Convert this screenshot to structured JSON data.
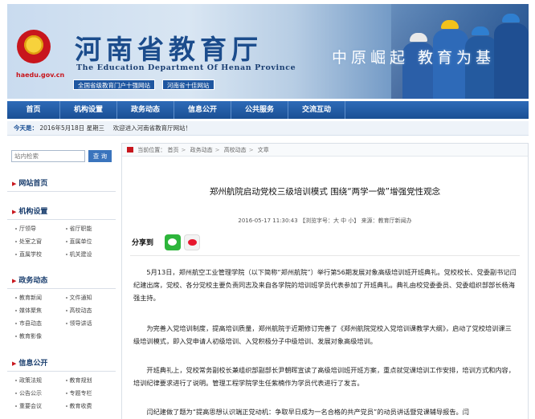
{
  "header": {
    "site_url": "haedu.gov.cn",
    "title_cn": "河南省教育厅",
    "title_en": "The Education Department Of Henan Province",
    "badge_1": "全国省级教育门户十强网站",
    "badge_2": "河南省十佳网站",
    "slogan": "中原崛起 教育为基"
  },
  "nav": {
    "items": [
      "首页",
      "机构设置",
      "政务动态",
      "信息公开",
      "公共服务",
      "交流互动"
    ]
  },
  "datebar": {
    "label": "今天是：",
    "date": "2016年5月18日 星期三",
    "welcome": "欢迎进入河南省教育厅网站！"
  },
  "sidebar": {
    "search_placeholder": "站内检索",
    "search_button": "查 询",
    "sections": [
      {
        "title": "网站首页",
        "links": []
      },
      {
        "title": "机构设置",
        "links": [
          "厅领导",
          "省厅职能",
          "处室之窗",
          "直属单位",
          "直属学校",
          "机关建设"
        ]
      },
      {
        "title": "政务动态",
        "links": [
          "教育新闻",
          "文件通知",
          "媒体聚焦",
          "高校动态",
          "市县动态",
          "领导讲话",
          "教育影像"
        ]
      },
      {
        "title": "信息公开",
        "links": [
          "政策法规",
          "教育规划",
          "公告公示",
          "专题专栏",
          "重要会议",
          "教育收费"
        ]
      }
    ]
  },
  "article": {
    "breadcrumb": [
      "当前位置：",
      "首页",
      "政务动态",
      "高校动态",
      "文章"
    ],
    "title": "郑州航院启动党校三级培训模式 围绕“两学一做”增强党性观念",
    "meta": "2016-05-17 11:30:43 【浏览字号：大 中 小】 来源：教育厅新闻办",
    "share_label": "分享到",
    "paragraphs": [
      "5月13日，郑州航空工业管理学院（以下简称“郑州航院”）举行第56期发展对象高级培训班开班典礼。党校校长、党委副书记闫纪建出席，党校、各分党校主要负责同志及来自各学院的培训班学员代表参加了开班典礼。典礼由校党委委员、党委组织部部长杨海强主持。",
      "为完善入党培训制度，提高培训质量，郑州航院于近期修订完善了《郑州航院党校入党培训课教学大纲》，启动了党校培训课三级培训模式，即入党申请人初级培训、入党积极分子中级培训、发展对象高级培训。",
      "开班典礼上，党校常务副校长兼组织部副部长尹朝晖宣读了高级培训班开班方案，重点就党课培训工作安排，培训方式和内容，培训纪律要求进行了说明。管理工程学院学生任紫楠作为学员代表进行了发言。",
      "闫纪建做了题为“提高思想认识端正党动机：争取早日成为一名合格的共产党员”的动员讲话暨党课辅导报告。闫"
    ]
  },
  "colors": {
    "primary": "#1a4f94",
    "accent": "#c8161d"
  }
}
